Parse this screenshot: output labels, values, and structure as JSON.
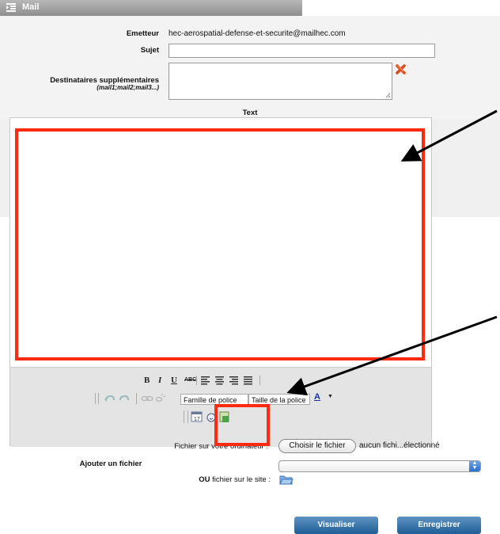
{
  "header": {
    "title": "Mail",
    "icon": "list-indent-icon"
  },
  "form": {
    "sender_label": "Emetteur",
    "sender_value": "hec-aerospatial-defense-et-securite@mailhec.com",
    "subject_label": "Sujet",
    "subject_value": "",
    "recipients_label": "Destinataires supplémentaires",
    "recipients_hint": "(mail1;mail2;mail3...)",
    "recipients_value": "",
    "text_label": "Text"
  },
  "toolbar": {
    "bold": "B",
    "italic": "I",
    "underline": "U",
    "strike": "ABC",
    "font_family": "Famille de police",
    "font_size": "Taille de la police",
    "font_color": "A"
  },
  "attach": {
    "section_label": "Ajouter un fichier",
    "computer_label": "Fichier sur votre ordinateur :",
    "choose_button": "Choisir le fichier",
    "no_file": "aucun fichi...électionné",
    "site_label_bold": "OU",
    "site_label_rest": "fichier sur le site :",
    "site_select_value": ""
  },
  "buttons": {
    "preview": "Visualiser",
    "save": "Enregistrer"
  },
  "colors": {
    "annotation_red": "#ff2a10",
    "button_blue": "#2a6aa3"
  }
}
